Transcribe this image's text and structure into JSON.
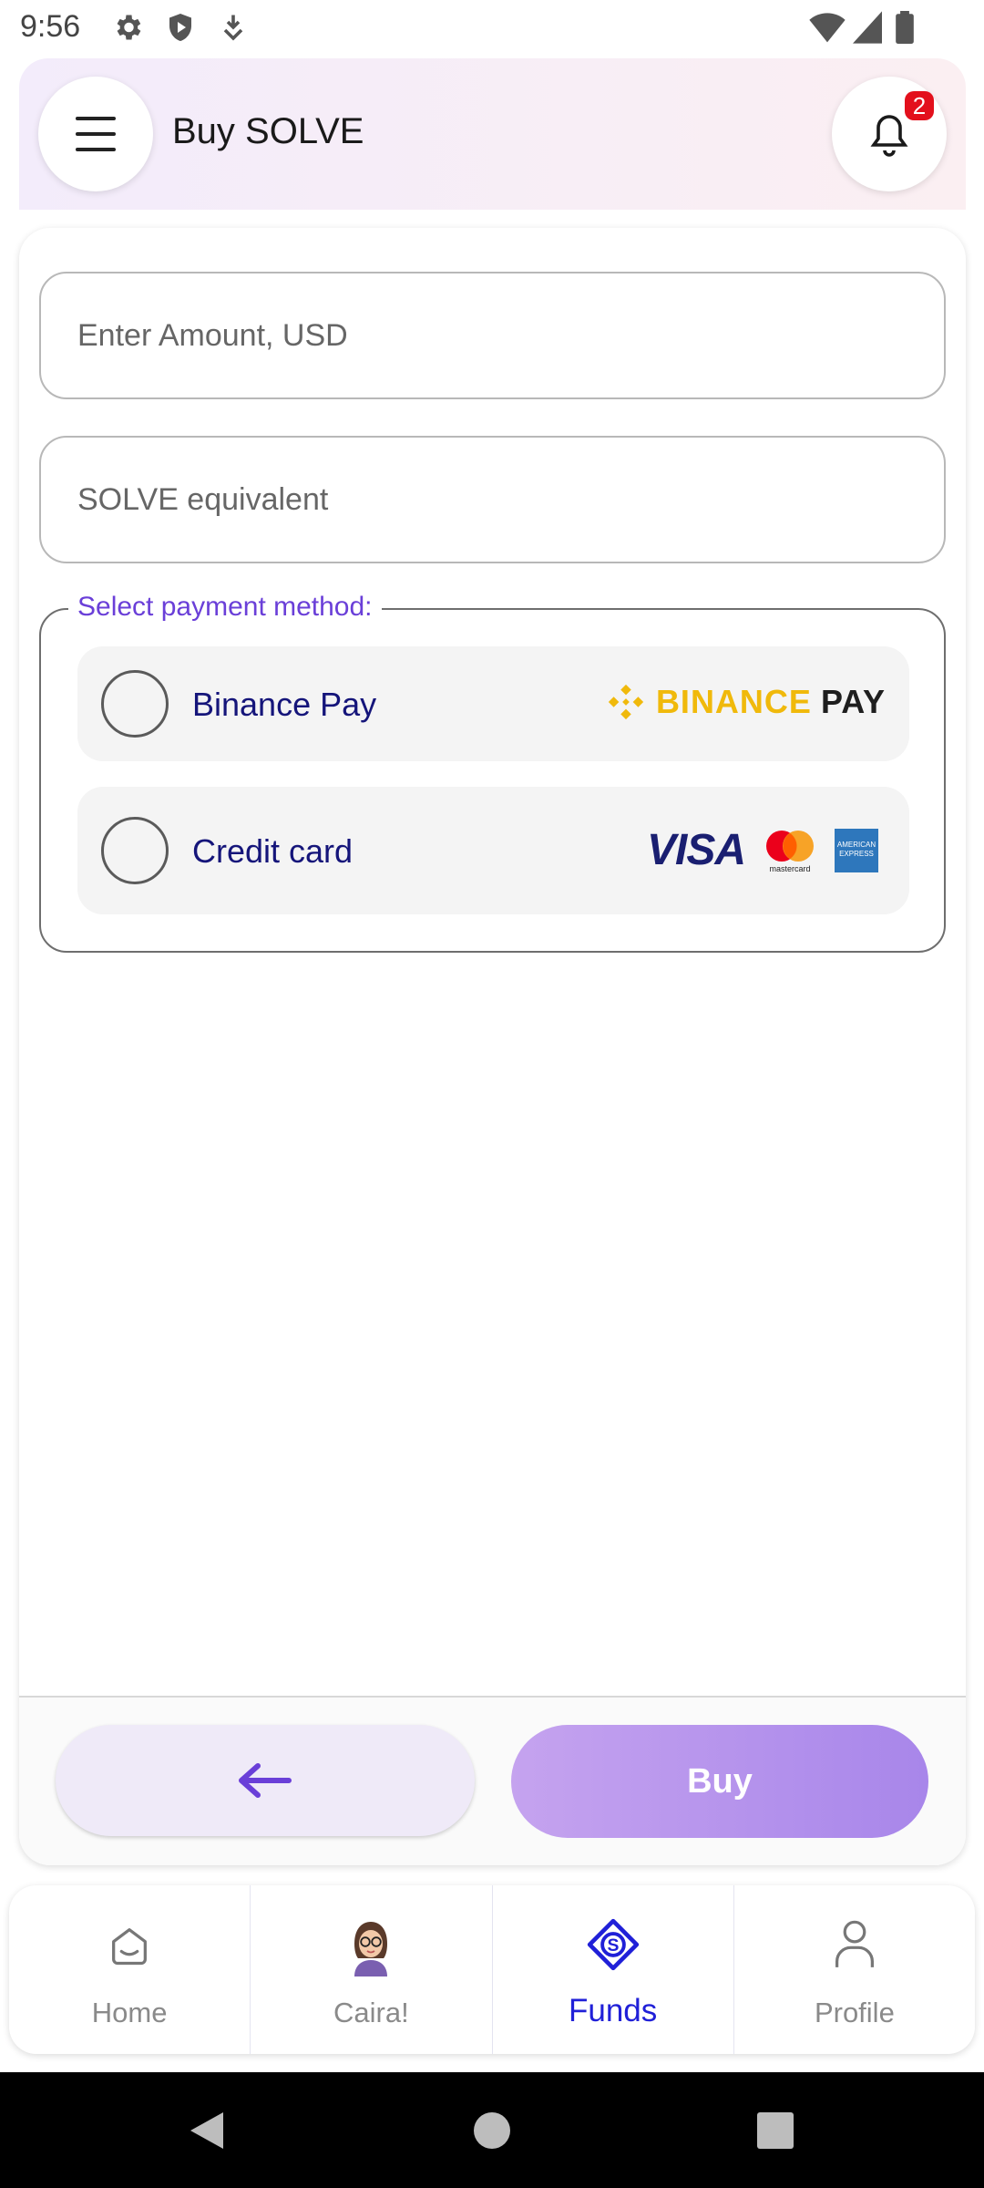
{
  "status_bar": {
    "time": "9:56"
  },
  "header": {
    "title": "Buy SOLVE",
    "notification_count": "2"
  },
  "form": {
    "amount_placeholder": "Enter Amount, USD",
    "solve_placeholder": "SOLVE equivalent",
    "payment_legend": "Select payment method:",
    "options": [
      {
        "label": "Binance Pay",
        "logo_text_1": "BINANCE",
        "logo_text_2": "PAY"
      },
      {
        "label": "Credit card",
        "logo_text": "VISA",
        "mastercard_text": "mastercard",
        "amex_text": "AMERICAN EXPRESS"
      }
    ]
  },
  "actions": {
    "buy_label": "Buy"
  },
  "nav": {
    "items": [
      {
        "label": "Home",
        "icon": "home-icon"
      },
      {
        "label": "Caira!",
        "icon": "avatar-icon"
      },
      {
        "label": "Funds",
        "icon": "funds-icon",
        "active": true
      },
      {
        "label": "Profile",
        "icon": "profile-icon"
      }
    ]
  },
  "colors": {
    "accent": "#6a3fd8",
    "active_nav": "#2020d8",
    "binance": "#f0b90b",
    "badge": "#e3101c"
  }
}
